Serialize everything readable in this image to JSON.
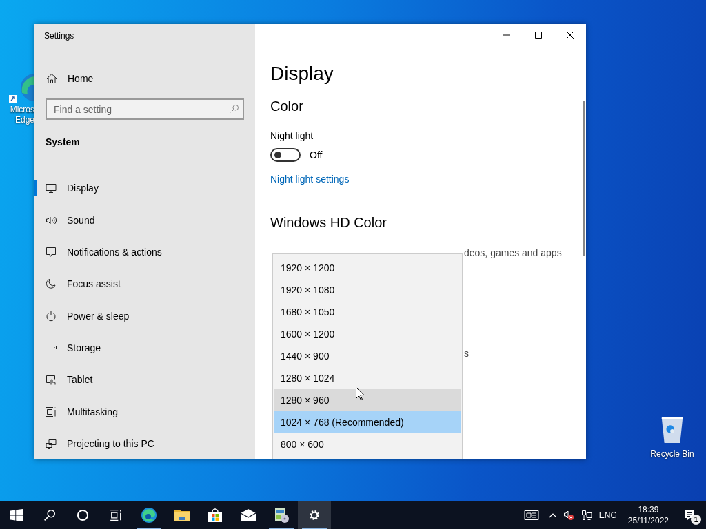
{
  "desktop_icons": [
    {
      "kind": "edge",
      "lines": [
        "Micros",
        "Edge"
      ]
    },
    {
      "kind": "recycle",
      "lines": [
        "Recycle Bin"
      ]
    }
  ],
  "window": {
    "title": "Settings"
  },
  "sidebar": {
    "home": "Home",
    "search": {
      "placeholder": "Find a setting"
    },
    "section": "System",
    "items": [
      {
        "kind": "display",
        "label": "Display",
        "selected": true
      },
      {
        "kind": "sound",
        "label": "Sound",
        "selected": false
      },
      {
        "kind": "notifications",
        "label": "Notifications & actions",
        "selected": false
      },
      {
        "kind": "focus",
        "label": "Focus assist",
        "selected": false
      },
      {
        "kind": "power",
        "label": "Power & sleep",
        "selected": false
      },
      {
        "kind": "storage",
        "label": "Storage",
        "selected": false
      },
      {
        "kind": "tablet",
        "label": "Tablet",
        "selected": false
      },
      {
        "kind": "multitasking",
        "label": "Multitasking",
        "selected": false
      },
      {
        "kind": "projecting",
        "label": "Projecting to this PC",
        "selected": false
      }
    ]
  },
  "content": {
    "title": "Display",
    "color_heading": "Color",
    "night_light": {
      "label": "Night light",
      "on": false,
      "state": "Off"
    },
    "night_link": "Night light settings",
    "hd_heading": "Windows HD Color",
    "partial_text": "deos, games and apps",
    "partial_fragment": "s"
  },
  "dropdown": {
    "items": [
      {
        "label": "1920 × 1200",
        "selected": false,
        "hovered": false
      },
      {
        "label": "1920 × 1080",
        "selected": false,
        "hovered": false
      },
      {
        "label": "1680 × 1050",
        "selected": false,
        "hovered": false
      },
      {
        "label": "1600 × 1200",
        "selected": false,
        "hovered": false
      },
      {
        "label": "1440 × 900",
        "selected": false,
        "hovered": false
      },
      {
        "label": "1280 × 1024",
        "selected": false,
        "hovered": false
      },
      {
        "label": "1280 × 960",
        "selected": false,
        "hovered": true
      },
      {
        "label": "1024 × 768 (Recommended)",
        "selected": true,
        "hovered": false
      },
      {
        "label": "800 × 600",
        "selected": false,
        "hovered": false
      }
    ]
  },
  "taskbar": {
    "apps": [
      {
        "kind": "start",
        "active": false,
        "running": false
      },
      {
        "kind": "search",
        "active": false,
        "running": false
      },
      {
        "kind": "cortana",
        "active": false,
        "running": false
      },
      {
        "kind": "taskview",
        "active": false,
        "running": false
      },
      {
        "kind": "edge",
        "active": false,
        "running": true
      },
      {
        "kind": "explorer",
        "active": false,
        "running": false
      },
      {
        "kind": "store",
        "active": false,
        "running": false
      },
      {
        "kind": "mail",
        "active": false,
        "running": false
      },
      {
        "kind": "app",
        "active": false,
        "running": true
      },
      {
        "kind": "settings",
        "active": true,
        "running": true
      }
    ],
    "language": "ENG",
    "time": "18:39",
    "date": "25/11/2022",
    "notification_count": "1"
  }
}
